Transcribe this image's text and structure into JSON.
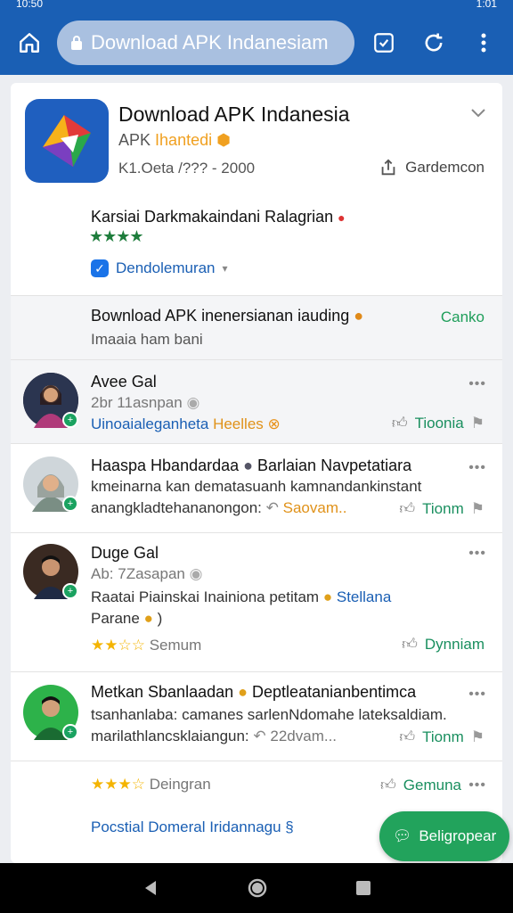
{
  "status": {
    "time_left": "10:50",
    "time_right": "1:01"
  },
  "browser": {
    "url": "Download APK Indanesiam"
  },
  "app": {
    "title": "Download APK Indanesia",
    "subtitle_prefix": "APK",
    "subtitle_tag": "Ihantedi",
    "meta": "K1.Oeta /??? - 2000",
    "share_label": "Gardemcon",
    "rating_title": "Karsiai Darkmakaindani Ralagrian",
    "rating_stars": "★★★★",
    "verified_label": "Dendolemuran"
  },
  "banner": {
    "title": "Bownload APK inenersianan iauding",
    "subtitle": "Imaaia ham bani",
    "action": "Canko"
  },
  "reviews": [
    {
      "name": "Avee Gal",
      "time": "2br 11asnpan",
      "line1": "Uinoaialeganheta",
      "tag": "Heelles",
      "like": "Tioonia"
    },
    {
      "name": "Haaspa Hbandardaa",
      "extra": "Barlaian Navpetatiara",
      "line1": "kmeinarna kan dematasuanh kamnandankinstant",
      "line2": "anangkladtehananongon:",
      "tag": "Saovam..",
      "like": "Tionm"
    },
    {
      "name": "Duge Gal",
      "time": "Ab: 7Zasapan",
      "line1": "Raatai Piainskai Inainiona petitam",
      "tag": "Stellana",
      "line2": "Parane",
      "stars": "★★☆☆",
      "stars_label": "Semum",
      "like": "Dynniam"
    },
    {
      "name": "Metkan Sbanlaadan",
      "extra": "Deptleatanianbentimca",
      "line1": "tsanhanlaba: camanes sarlenNdomahe lateksaldiam.",
      "line2": "marilathlancsklaiangun:",
      "tag": "22dvam...",
      "like": "Tionm"
    }
  ],
  "footer_row": {
    "stars": "★★★☆",
    "label": "Deingran",
    "like": "Gemuna"
  },
  "bottom_link": "Pocstial Domeral Iridannagu",
  "fab_label": "Beligropear",
  "colors": {
    "brand_blue": "#1a5fb4",
    "accent_green": "#22a35c",
    "star": "#f4b400"
  }
}
